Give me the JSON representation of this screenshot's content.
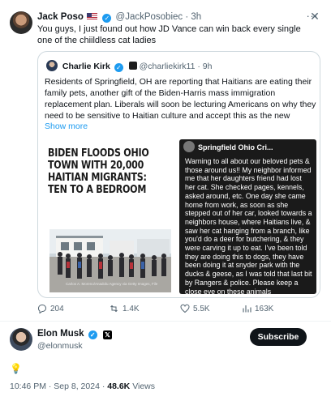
{
  "tweet": {
    "author_name": "Jack Poso",
    "author_handle": "@JackPosobiec",
    "time": "· 3h",
    "text": "You guys, I just found out how JD Vance can win back every single one of the chiildless cat ladies",
    "more_icon": "more-icon",
    "close_icon": "close-icon"
  },
  "quote": {
    "author_name": "Charlie Kirk",
    "author_handle": "@charliekirk11",
    "time": "· 9h",
    "text": "Residents of Springfield, OH are reporting that Haitians are eating their family pets, another gift of the Biden-Harris mass immigration replacement plan. Liberals will soon be lecturing Americans on why they need to be sensitive to Haitian culture and accept this as the new",
    "show_more": "Show more",
    "image_left": {
      "headline": "BIDEN FLOODS OHIO TOWN WITH 20,000 HAITIAN MIGRANTS: TEN TO A BEDROOM",
      "caption": "Carlos A. Moreno/Anadolu Agency via Getty Images, File"
    },
    "image_right": {
      "group_name": "Springfield Ohio Cri...",
      "post_text": "Warning to all about our beloved pets & those around us!! My neighbor informed me that her daughters friend had lost her cat. She checked pages, kennels, asked around, etc. One day she came home from work, as soon as she stepped out of her car, looked towards a neighbors house, where Haitians live, & saw her cat hanging from a branch, like you'd do a deer for butchering, & they were carving it up to eat. I've been told they are doing this to dogs, they have been doing it at snyder park with the ducks & geese, as I was told that last bit by Rangers & police. Please keep a close eye on these animals"
    }
  },
  "actions": {
    "replies": "204",
    "reposts": "1.4K",
    "likes": "5.5K",
    "views": "163K"
  },
  "reply": {
    "author_name": "Elon Musk",
    "author_handle": "@elonmusk",
    "subscribe_label": "Subscribe",
    "text": "💡",
    "timestamp": "10:46 PM · Sep 8, 2024 · ",
    "views_count": "48.6K",
    "views_label": " Views"
  },
  "colors": {
    "accent": "#1d9bf0",
    "text": "#0f1419",
    "secondary": "#536471",
    "border": "#cfd9de"
  }
}
